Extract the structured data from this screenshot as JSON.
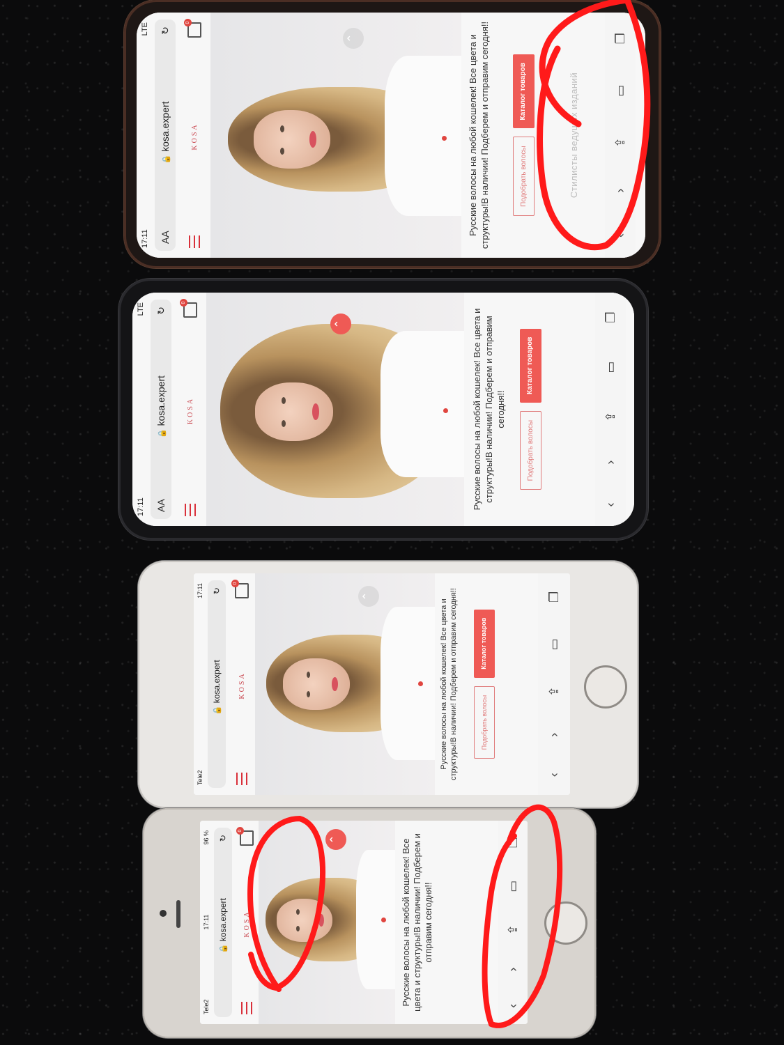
{
  "phones": [
    {
      "status_time": "17:11",
      "status_signal": "LTE",
      "url_text_size": "AA",
      "url": "kosa.expert",
      "logo": "KOSA",
      "cart_count": "0",
      "tagline": "Русские волосы на любой кошелек! Все цвета и структуры!В наличии! Подберем и отправим сегодня!!",
      "button_outline": "Подобрать волосы",
      "button_solid": "Каталог товаров",
      "section_heading": "Стилисты ведущих изданий"
    },
    {
      "status_time": "17:11",
      "status_signal": "LTE",
      "url_text_size": "AA",
      "url": "kosa.expert",
      "logo": "KOSA",
      "cart_count": "0",
      "tagline": "Русские волосы на любой кошелек! Все цвета и структуры!В наличии! Подберем и отправим сегодня!!",
      "button_outline": "Подобрать волосы",
      "button_solid": "Каталог товаров"
    },
    {
      "status_time": "17:11",
      "status_carrier": "Tele2",
      "url": "kosa.expert",
      "logo": "KOSA",
      "cart_count": "0",
      "tagline": "Русские волосы на любой кошелек! Все цвета и структуры!В наличии! Подберем и отправим сегодня!!",
      "button_outline": "Подобрать волосы",
      "button_solid": "Каталог товаров"
    },
    {
      "status_time": "17:11",
      "status_carrier": "Tele2",
      "status_battery": "96 %",
      "url": "kosa.expert",
      "logo": "KOSA",
      "cart_count": "0",
      "tagline": "Русские волосы на любой кошелек! Все цвета и структуры!В наличии! Подберем и отправим сегодня!!"
    }
  ],
  "icons": {
    "reload": "reload-icon",
    "lock": "lock-icon",
    "menu": "hamburger-menu-icon",
    "cart": "cart-icon",
    "scroll_up": "chevron-up-icon",
    "share": "share-icon",
    "bookmarks": "book-icon",
    "tabs": "tabs-icon",
    "back": "chevron-left-icon",
    "forward": "chevron-right-icon"
  },
  "colors": {
    "brand_red": "#ef5a55",
    "annotation_red": "#ff1a1a",
    "link_blue": "#3a77d8"
  }
}
